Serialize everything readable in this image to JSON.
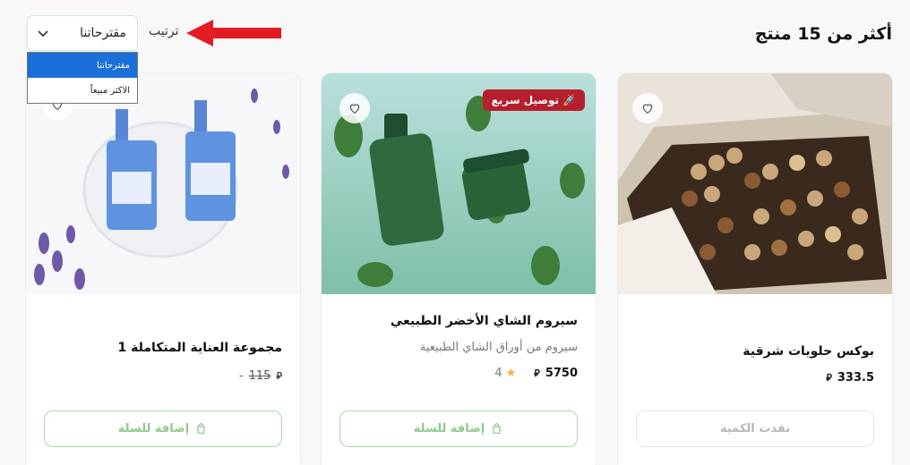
{
  "header": {
    "count_title": "أكثر من 15 منتج",
    "sort_label": "ترتيب",
    "sort_selected": "مقترحاتنا",
    "sort_options": [
      "مقترحاتنا",
      "الاكثر مبيعاً"
    ]
  },
  "currency_symbol": "⃁",
  "products": [
    {
      "name": "بوكس حلويات شرقية",
      "price": "333.5",
      "button_label": "نفدت الكمية"
    },
    {
      "name": "سيروم الشاي الأخضر الطبيعي",
      "description": "سيروم من أوراق الشاي الطبيعية",
      "price": "5750",
      "rating": "4",
      "badge": "توصيل سريع",
      "button_label": "إضافة للسلة"
    },
    {
      "name": "مجموعة العناية المتكاملة 1",
      "old_price": "115",
      "price_dash": "-",
      "button_label": "إضافة للسلة"
    }
  ],
  "colors": {
    "accent": "#8fc98f",
    "badge": "#b51f2e",
    "dropdown_active": "#1a6fd8",
    "arrow": "#e31b23"
  }
}
